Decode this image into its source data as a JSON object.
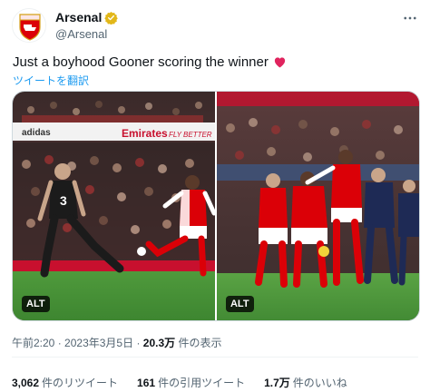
{
  "author": {
    "display_name": "Arsenal",
    "handle": "@Arsenal",
    "avatar_icon": "arsenal-crest-icon",
    "verified_icon": "gold-verified-badge-icon",
    "verified_color": "#e2b719"
  },
  "tweet": {
    "text": "Just a boyhood Gooner scoring the winner",
    "emoji_icon": "red-heart-icon",
    "translate_label": "ツイートを翻訳"
  },
  "media": {
    "photos": [
      {
        "alt_label": "ALT",
        "boards": [
          "Emirates",
          "FLY BETTER"
        ]
      },
      {
        "alt_label": "ALT"
      }
    ]
  },
  "meta": {
    "time": "午前2:20",
    "separator": "·",
    "date": "2023年3月5日",
    "views_count": "20.3万",
    "views_label": "件の表示"
  },
  "stats": {
    "retweets_count": "3,062",
    "retweets_label": "件のリツイート",
    "quotes_count": "161",
    "quotes_label": "件の引用ツイート",
    "likes_count": "1.7万",
    "likes_label": "件のいいね"
  },
  "colors": {
    "accent": "#1d9bf0",
    "text": "#0f1419",
    "secondary": "#536471",
    "arsenal_red": "#db0007"
  }
}
